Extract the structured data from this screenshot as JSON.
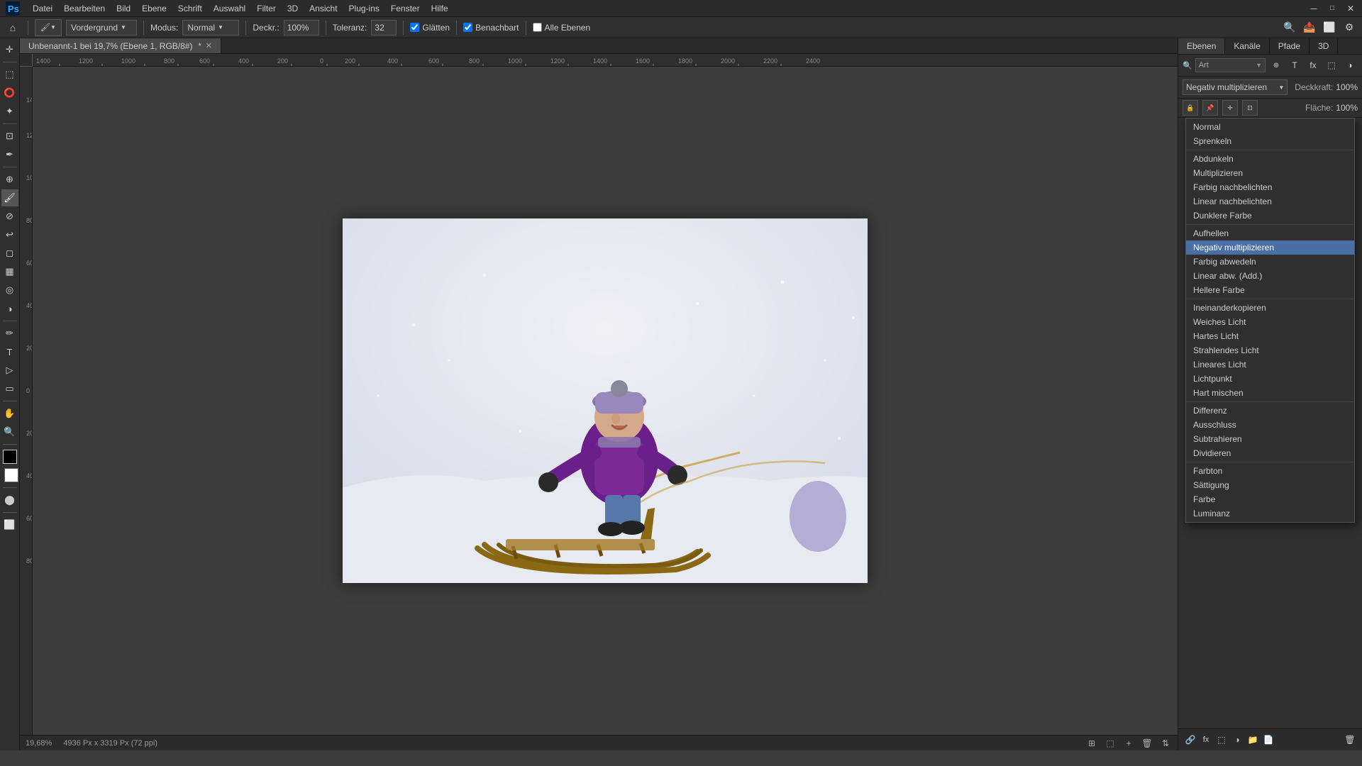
{
  "app": {
    "title": "Adobe Photoshop",
    "document_tab": "Unbenannt-1 bei 19,7% (Ebene 1, RGB/8#)",
    "is_modified": true
  },
  "menubar": {
    "items": [
      "Datei",
      "Bearbeiten",
      "Bild",
      "Ebene",
      "Schrift",
      "Auswahl",
      "Filter",
      "3D",
      "Ansicht",
      "Plug-ins",
      "Fenster",
      "Hilfe"
    ]
  },
  "toolbar": {
    "brush_preset": "Vordergrund",
    "modus_label": "Modus:",
    "modus_value": "Normal",
    "deckraft_label": "Deckr.:",
    "deckraft_value": "100%",
    "toleranz_label": "Toleranz:",
    "toleranz_value": "32",
    "glaetten_label": "Glätten",
    "glaetten_checked": true,
    "benachbart_label": "Benachbart",
    "benachbart_checked": true,
    "alle_ebenen_label": "Alle Ebenen",
    "alle_ebenen_checked": false
  },
  "tab": {
    "name": "Unbenannt-1 bei 19,7% (Ebene 1, RGB/8#)",
    "is_modified": true
  },
  "status_bar": {
    "zoom": "19,68%",
    "dimensions": "4936 Px x 3319 Px (72 ppi)"
  },
  "right_panel": {
    "tabs": [
      "Ebenen",
      "Kanäle",
      "Pfade",
      "3D"
    ],
    "active_tab": "Ebenen",
    "search_placeholder": "Art",
    "blend_mode_selected": "Negativ multiplizieren",
    "deckraft_label": "Deckkraft:",
    "deckraft_value": "100%",
    "flaeche_label": "Fläche:",
    "flaeche_value": "100%"
  },
  "blend_modes": {
    "groups": [
      {
        "items": [
          "Normal",
          "Sprenkeln"
        ]
      },
      {
        "items": [
          "Abdunkeln",
          "Multiplizieren",
          "Farbig nachbelichten",
          "Linear nachbelichten",
          "Dunklere Farbe"
        ]
      },
      {
        "items": [
          "Aufhellen",
          "Negativ multiplizieren",
          "Farbig abwedeln",
          "Linear abw. (Add.)",
          "Hellere Farbe"
        ]
      },
      {
        "items": [
          "Ineinanderkopieren",
          "Weiches Licht",
          "Hartes Licht",
          "Strahlendes Licht",
          "Lineares Licht",
          "Lichtpunkt",
          "Hart mischen"
        ]
      },
      {
        "items": [
          "Differenz",
          "Ausschluss",
          "Subtrahieren",
          "Dividieren"
        ]
      },
      {
        "items": [
          "Farbton",
          "Sättigung",
          "Farbe",
          "Luminanz"
        ]
      }
    ]
  }
}
